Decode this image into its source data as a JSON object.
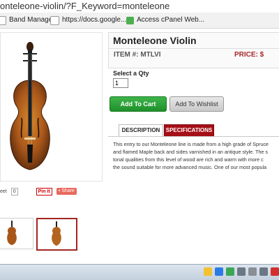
{
  "browser": {
    "url": "onteleone-violin/?F_Keyword=monteleone",
    "bookmarks": [
      {
        "label": "Band Manager",
        "icon": "page-icon"
      },
      {
        "label": "https://docs.google....",
        "icon": "google-docs-icon"
      },
      {
        "label": "Access cPanel Web...",
        "icon": "cpanel-icon"
      }
    ]
  },
  "product": {
    "title": "Monteleone Violin",
    "item_label": "ITEM #: MTLVI",
    "price_label": "PRICE: $",
    "qty_label": "Select a Qty",
    "qty_value": "1",
    "add_to_cart": "Add To Cart",
    "add_to_wishlist": "Add To Wishlist",
    "tabs": [
      "DESCRIPTION",
      "SPECIFICATIONS"
    ],
    "description_lines": [
      "This entry to our Monteleone line is made from a high grade of Spruce",
      "and flamed Maple back and sides varnished in an antique style. The s",
      "tonal qualities from this level of wood are rich and warm with more c",
      "the sound suitable for more advanced music. One of our most popula"
    ]
  },
  "share": {
    "tweet_label": "eet",
    "tweet_count": "0",
    "pin_label": "Pin it",
    "share_label": "Share"
  },
  "colors": {
    "price_red": "#a9262a",
    "cart_green": "#1f8f2b",
    "spec_tab_red": "#a50f16",
    "thumb_selected": "#a3251f"
  }
}
